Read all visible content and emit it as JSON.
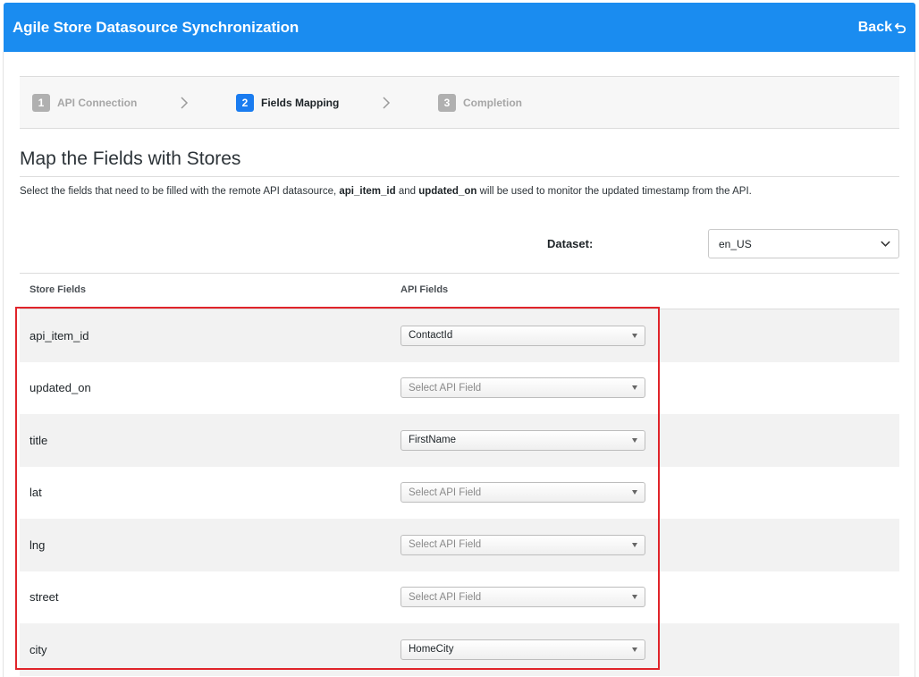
{
  "header": {
    "title": "Agile Store Datasource Synchronization",
    "back_label": "Back",
    "back_icon": "undo-arrow-icon",
    "color": "#1a8cf0"
  },
  "stepper": {
    "steps": [
      {
        "number": "1",
        "label": "API Connection",
        "active": false
      },
      {
        "number": "2",
        "label": "Fields Mapping",
        "active": true
      },
      {
        "number": "3",
        "label": "Completion",
        "active": false
      }
    ],
    "separator_icon": "chevron-right-icon"
  },
  "main": {
    "title": "Map the Fields with Stores",
    "description": {
      "part1": "Select the fields that need to be filled with the remote API datasource, ",
      "bold1": "api_item_id",
      "part2": " and ",
      "bold2": "updated_on",
      "part3": " will be used to monitor the updated timestamp from the API."
    },
    "dataset": {
      "label": "Dataset:",
      "value": "en_US"
    },
    "table": {
      "headers": {
        "store": "Store Fields",
        "api": "API Fields"
      },
      "rows": [
        {
          "field": "api_item_id",
          "api_value": "ContactId",
          "placeholder": false
        },
        {
          "field": "updated_on",
          "api_value": "Select API Field",
          "placeholder": true
        },
        {
          "field": "title",
          "api_value": "FirstName",
          "placeholder": false
        },
        {
          "field": "lat",
          "api_value": "Select API Field",
          "placeholder": true
        },
        {
          "field": "lng",
          "api_value": "Select API Field",
          "placeholder": true
        },
        {
          "field": "street",
          "api_value": "Select API Field",
          "placeholder": true
        },
        {
          "field": "city",
          "api_value": "HomeCity",
          "placeholder": false
        }
      ]
    },
    "highlight_color": "#e0242a"
  }
}
